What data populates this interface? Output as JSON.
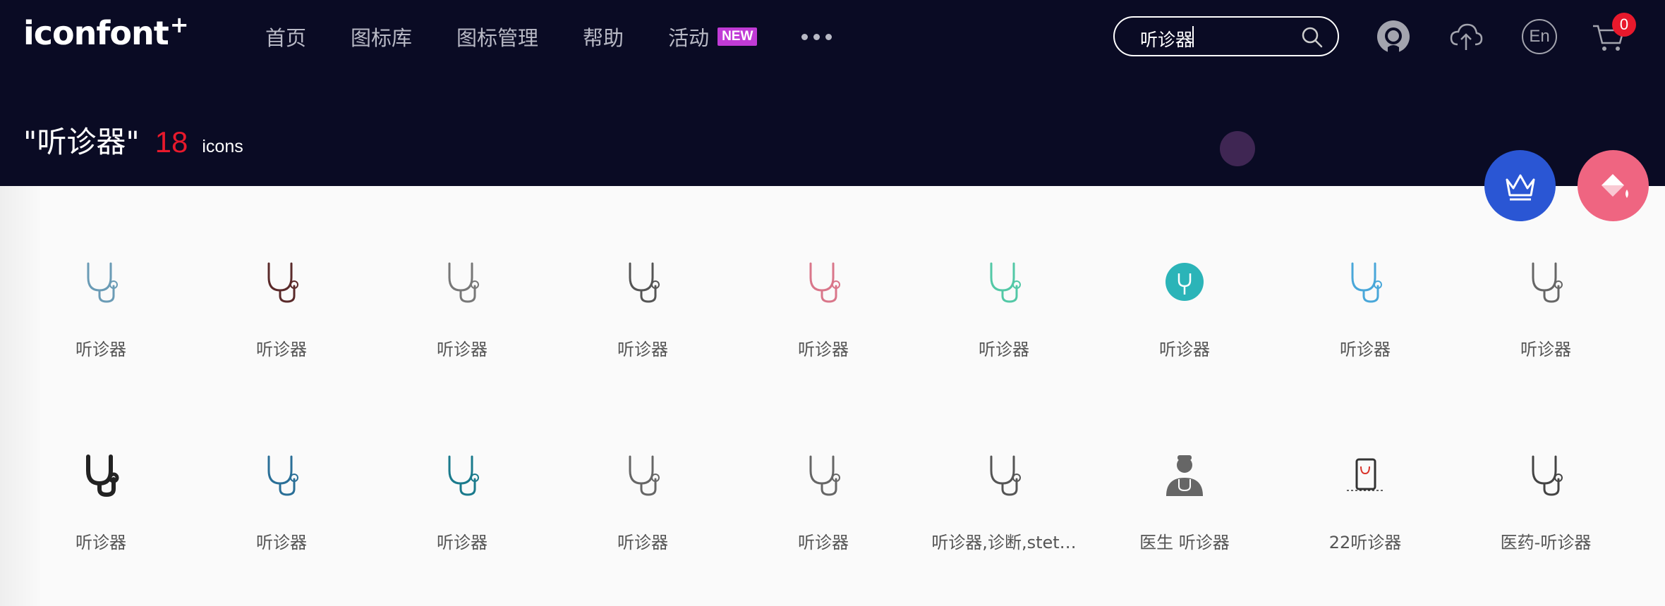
{
  "header": {
    "logo": "iconfont",
    "logo_plus": "+",
    "nav": [
      {
        "label": "首页"
      },
      {
        "label": "图标库"
      },
      {
        "label": "图标管理"
      },
      {
        "label": "帮助"
      },
      {
        "label": "活动",
        "badge": "NEW"
      }
    ],
    "search": {
      "value": "听诊器"
    },
    "lang_label": "En",
    "cart_count": "0"
  },
  "results": {
    "query": "\"听诊器\"",
    "count": "18",
    "unit": "icons"
  },
  "icons": [
    {
      "label": "听诊器",
      "icon": "stethoscope-icon",
      "color": "#6a9bb5"
    },
    {
      "label": "听诊器",
      "icon": "stethoscope-icon",
      "color": "#5a2a2a"
    },
    {
      "label": "听诊器",
      "icon": "stethoscope-icon",
      "color": "#777777"
    },
    {
      "label": "听诊器",
      "icon": "stethoscope-icon",
      "color": "#555555"
    },
    {
      "label": "听诊器",
      "icon": "stethoscope-icon",
      "color": "#d9768a"
    },
    {
      "label": "听诊器",
      "icon": "stethoscope-icon",
      "color": "#53c8a6"
    },
    {
      "label": "听诊器",
      "icon": "stethoscope-circle-icon",
      "color": "#2bb4b8"
    },
    {
      "label": "听诊器",
      "icon": "stethoscope-icon",
      "color": "#49a7d9"
    },
    {
      "label": "听诊器",
      "icon": "stethoscope-icon",
      "color": "#666666"
    },
    {
      "label": "听诊器",
      "icon": "stethoscope-bold-icon",
      "color": "#222222"
    },
    {
      "label": "听诊器",
      "icon": "stethoscope-icon",
      "color": "#2a6f97"
    },
    {
      "label": "听诊器",
      "icon": "stethoscope-icon",
      "color": "#1a7a8c"
    },
    {
      "label": "听诊器",
      "icon": "stethoscope-icon",
      "color": "#666666"
    },
    {
      "label": "听诊器",
      "icon": "stethoscope-icon",
      "color": "#666666"
    },
    {
      "label": "听诊器,诊断,stet…",
      "icon": "stethoscope-icon",
      "color": "#555555"
    },
    {
      "label": "医生 听诊器",
      "icon": "doctor-icon",
      "color": "#666666"
    },
    {
      "label": "22听诊器",
      "icon": "phone-stethoscope-icon",
      "color": "#333333"
    },
    {
      "label": "医药-听诊器",
      "icon": "stethoscope-icon",
      "color": "#444444"
    }
  ]
}
